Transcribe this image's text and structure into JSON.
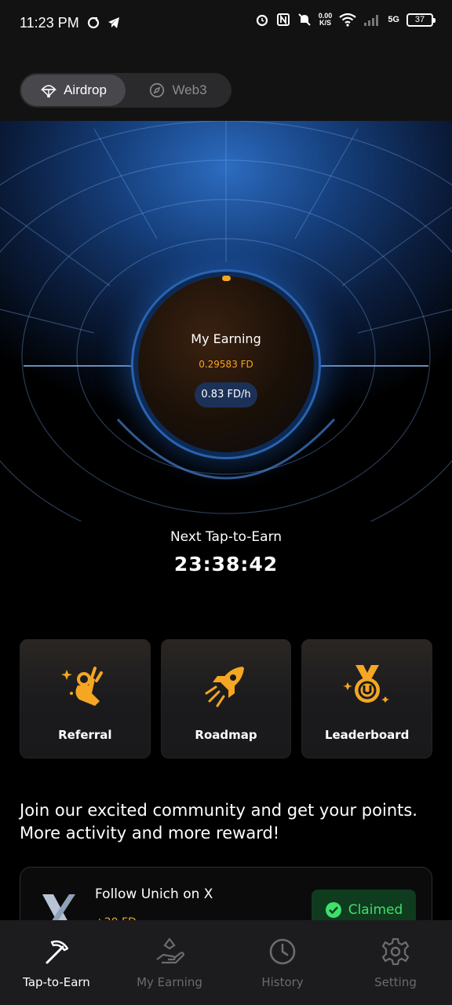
{
  "status_bar": {
    "time": "11:23 PM",
    "net_speed_value": "0.00",
    "net_speed_unit": "K/S",
    "network": "5G",
    "battery": "37",
    "icons": [
      "sync-icon",
      "telegram-icon",
      "alarm-icon",
      "nfc-icon",
      "mute-icon",
      "wifi-icon",
      "signal-icon"
    ]
  },
  "header": {
    "tabs": [
      {
        "label": "Airdrop",
        "icon": "parachute-icon",
        "active": true
      },
      {
        "label": "Web3",
        "icon": "compass-icon",
        "active": false
      }
    ]
  },
  "hero": {
    "title": "My Earning",
    "value": "0.29583 FD",
    "rate": "0.83 FD/h",
    "next_label": "Next Tap-to-Earn",
    "next_time": "23:38:42"
  },
  "actions": [
    {
      "label": "Referral",
      "icon": "ok-hand-icon"
    },
    {
      "label": "Roadmap",
      "icon": "rocket-icon"
    },
    {
      "label": "Leaderboard",
      "icon": "medal-icon"
    }
  ],
  "community_text_line1": "Join our excited community and get your points.",
  "community_text_line2": "More activity and more reward!",
  "task": {
    "title": "Follow Unich on X",
    "reward": "+20 FD",
    "status": "Claimed"
  },
  "bottom_nav": [
    {
      "label": "Tap-to-Earn",
      "icon": "pickaxe-icon",
      "active": true
    },
    {
      "label": "My Earning",
      "icon": "hand-coin-icon",
      "active": false
    },
    {
      "label": "History",
      "icon": "clock-icon",
      "active": false
    },
    {
      "label": "Setting",
      "icon": "gear-icon",
      "active": false
    }
  ],
  "colors": {
    "accent": "#f5a623",
    "success": "#3ee06b",
    "hero_blue": "#2c6cc0"
  }
}
